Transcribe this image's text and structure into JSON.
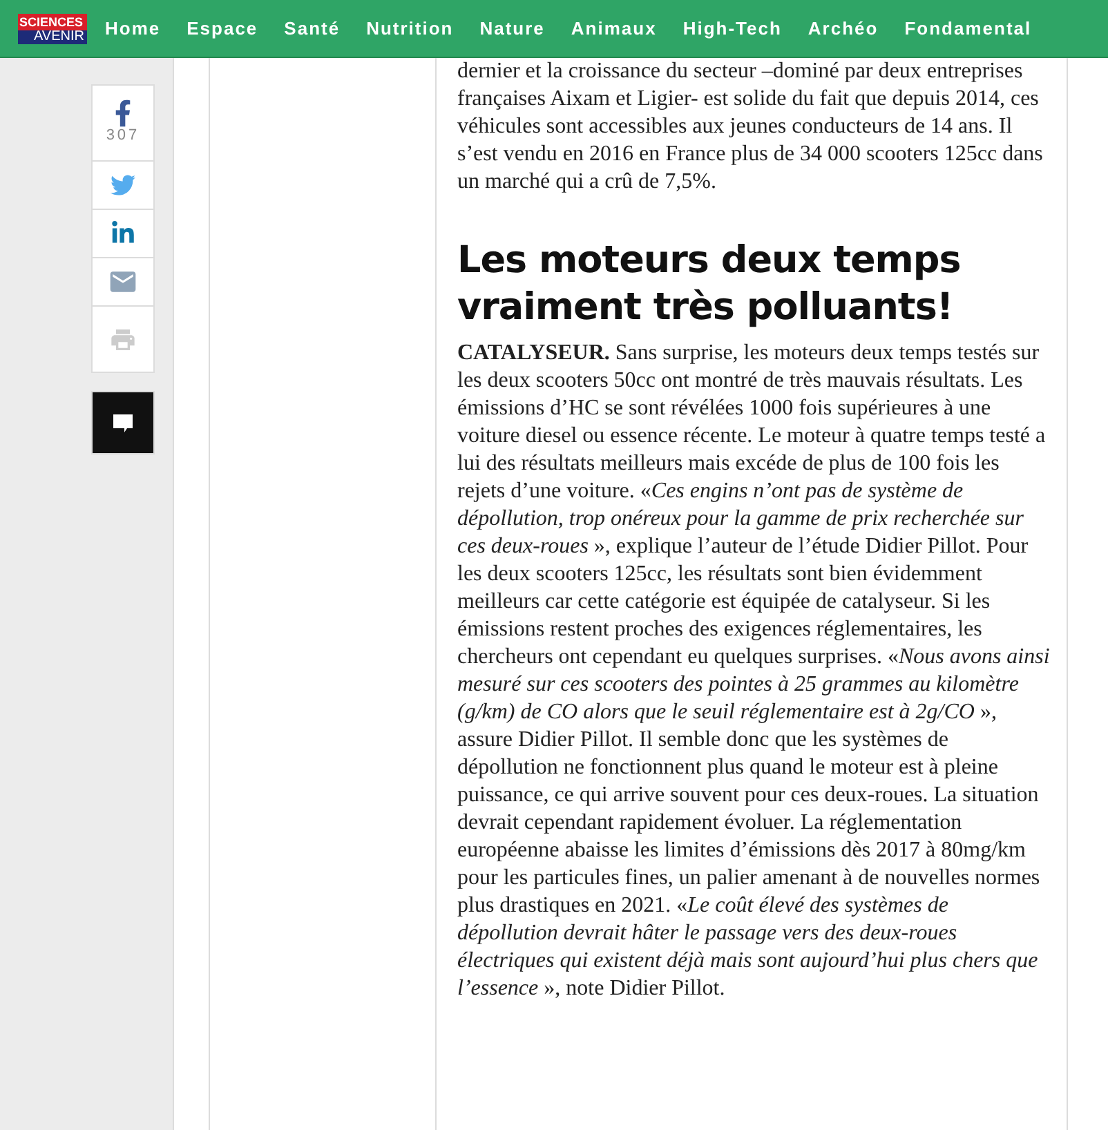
{
  "header": {
    "logo": {
      "top": "SCIENCES",
      "bottom": "AVENIR"
    },
    "nav": [
      {
        "label": "Home"
      },
      {
        "label": "Espace"
      },
      {
        "label": "Santé"
      },
      {
        "label": "Nutrition"
      },
      {
        "label": "Nature"
      },
      {
        "label": "Animaux"
      },
      {
        "label": "High-Tech"
      },
      {
        "label": "Archéo"
      },
      {
        "label": "Fondamental"
      }
    ]
  },
  "share": {
    "count": "307",
    "buttons": [
      {
        "kind": "facebook"
      },
      {
        "kind": "twitter"
      },
      {
        "kind": "linkedin"
      },
      {
        "kind": "email"
      },
      {
        "kind": "print"
      }
    ]
  },
  "article": {
    "blocks": [
      {
        "kind": "paragraph",
        "text": "dernier et la croissance du secteur –dominé par deux entreprises françaises Aixam et Ligier- est solide du fait que depuis 2014, ces véhicules sont accessibles aux jeunes conducteurs de 14 ans. Il s’est vendu en 2016 en France plus de 34 000 scooters 125cc dans un marché qui a crû de 7,5%."
      },
      {
        "kind": "heading",
        "text": "Les moteurs deux temps vraiment très polluants!"
      },
      {
        "kind": "paragraph",
        "text": "**CATALYSEUR.** Sans surprise, les moteurs deux temps testés sur les deux scooters 50cc ont montré de très mauvais résultats. Les émissions d’HC se sont révélées 1000 fois supérieures à une voiture diesel ou essence récente. Le moteur à quatre temps testé a lui des résultats meilleurs mais excéde de plus de 100 fois les rejets d’une voiture. «*Ces engins n’ont pas de système de dépollution, trop onéreux pour la gamme de prix recherchée sur ces deux-roues* », explique l’auteur de l’étude Didier Pillot. Pour les deux scooters 125cc, les résultats sont bien évidemment meilleurs car cette catégorie est équipée de catalyseur. Si les émissions restent proches des exigences réglementaires, les chercheurs ont cependant eu quelques surprises. «*Nous avons ainsi mesuré sur ces scooters des pointes à 25 grammes au kilomètre (g/km) de CO alors que le seuil réglementaire est à 2g/CO* », assure Didier Pillot. Il semble donc que les systèmes de dépollution ne fonctionnent plus quand le moteur est à pleine puissance, ce qui arrive souvent pour ces deux-roues. La situation devrait cependant rapidement évoluer. La réglementation européenne abaisse les limites d’émissions dès 2017 à 80mg/km pour les particules fines, un palier amenant à de nouvelles normes plus drastiques en 2021. «*Le coût élevé des systèmes de dépollution devrait hâter le passage vers des deux-roues électriques qui existent déjà mais sont aujourd’hui plus chers que l’essence* », note Didier Pillot."
      }
    ]
  }
}
